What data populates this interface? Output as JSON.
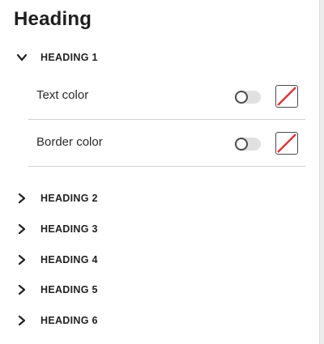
{
  "panel": {
    "title": "Heading"
  },
  "sections": [
    {
      "label": "HEADING 1",
      "expanded": true,
      "properties": [
        {
          "label": "Text color",
          "toggle_on": false,
          "swatch": "none"
        },
        {
          "label": "Border color",
          "toggle_on": false,
          "swatch": "none"
        }
      ]
    },
    {
      "label": "HEADING 2",
      "expanded": false
    },
    {
      "label": "HEADING 3",
      "expanded": false
    },
    {
      "label": "HEADING 4",
      "expanded": false
    },
    {
      "label": "HEADING 5",
      "expanded": false
    },
    {
      "label": "HEADING 6",
      "expanded": false
    }
  ],
  "icons": {
    "expanded": "chevron-down-icon",
    "collapsed": "chevron-right-icon",
    "swatch": "no-color-swatch-icon"
  },
  "colors": {
    "no_color_slash": "#d7373f",
    "toggle_track_off": "#e1e1e1"
  }
}
